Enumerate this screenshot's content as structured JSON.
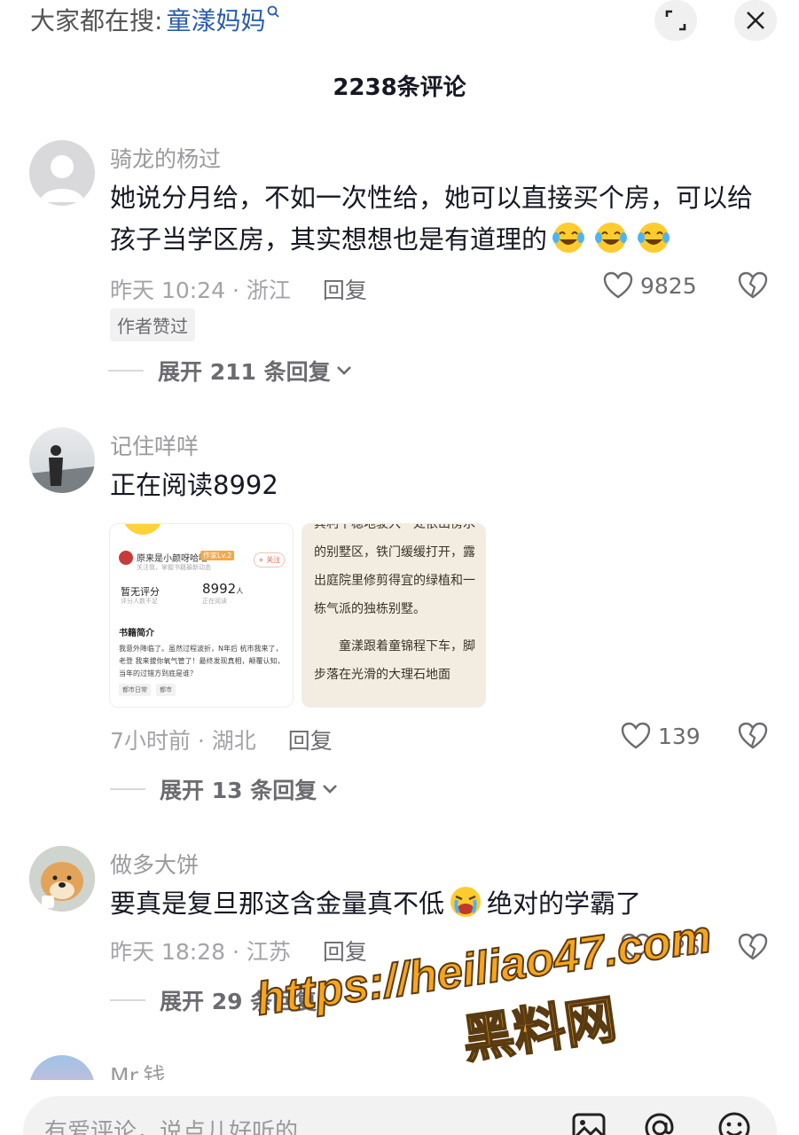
{
  "header": {
    "search_prefix": "大家都在搜:",
    "search_keyword": "童漾妈妈",
    "comment_count": "2238条评论"
  },
  "comments": [
    {
      "username": "骑龙的杨过",
      "text": "她说分月给，不如一次性给，她可以直接买个房，可以给孩子当学区房，其实想想也是有道理的",
      "emojis": [
        "tears-of-joy",
        "tears-of-joy",
        "tears-of-joy"
      ],
      "time_location": "昨天 10:24 · 浙江",
      "reply_label": "回复",
      "likes": "9825",
      "badge": "作者赞过",
      "expand_label": "展开 211 条回复"
    },
    {
      "username": "记住咩咩",
      "text": "正在阅读8992",
      "time_location": "7小时前 · 湖北",
      "reply_label": "回复",
      "likes": "139",
      "expand_label": "展开 13 条回复",
      "images": {
        "book_card": {
          "author_name": "原来是小颜呀哈哈",
          "author_tag": "作家Lv.2",
          "author_sub": "关注我，掌握书籍最新动态",
          "follow_label": "+ 关注",
          "score_label": "暂无评分",
          "score_sub": "评分人数不足",
          "readers": "8992",
          "readers_unit": "人",
          "readers_sub": "正在阅读",
          "intro_title": "书籍简介",
          "intro_text": "我意外降临了。虽然过程波折，N年后 杭市我来了，老登 我来拔你氧气管了！最终发现真相，颠覆认知，当年的过错方到底是谁？",
          "tags": [
            "都市日常",
            "都市"
          ]
        },
        "book_page": {
          "line1": "宾利平稳地驶入一处依山傍水的别墅区，铁门缓缓打开，露出庭院里修剪得宜的绿植和一栋气派的独栋别墅。",
          "line2": "童漾跟着童锦程下车，脚步落在光滑的大理石地面"
        }
      }
    },
    {
      "username": "做多大饼",
      "text_before": "要真是复旦那这含金量真不低",
      "emoji": "crying-face",
      "text_after": "绝对的学霸了",
      "time_location": "昨天 18:28 · 江苏",
      "reply_label": "回复",
      "likes": "726",
      "expand_label": "展开 29 条回复"
    },
    {
      "username": "Mr.钱"
    }
  ],
  "watermark": {
    "url": "https://heiliao47.com",
    "name": "黑料网"
  },
  "input": {
    "placeholder": "有爱评论，说点儿好听的"
  },
  "colors": {
    "keyword_blue": "#2a5caa",
    "watermark_orange": "#f6a51c"
  }
}
